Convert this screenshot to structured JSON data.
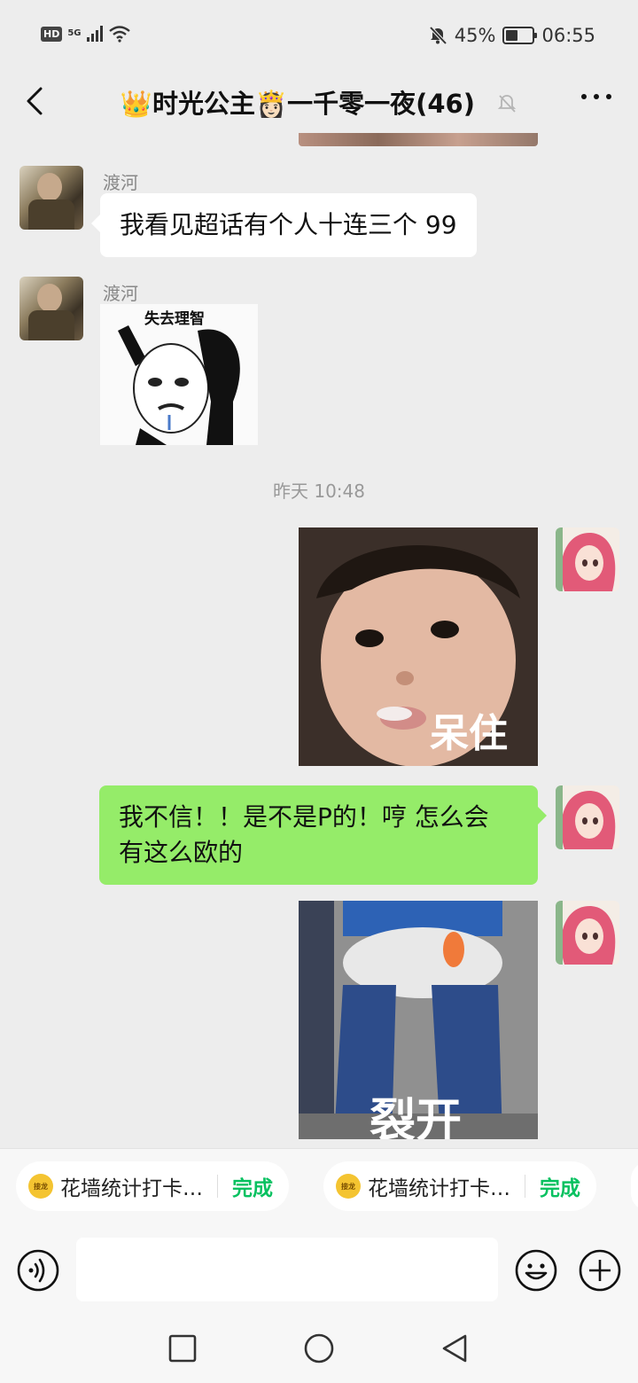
{
  "status_bar": {
    "battery": "45%",
    "time": "06:55",
    "network": "5G",
    "hd_label": "HD"
  },
  "header": {
    "title": "👑时光公主👸🏻一千零一夜(46)"
  },
  "messages": [
    {
      "sender": "渡河",
      "text": "我看见超话有个人十连三个 99"
    },
    {
      "sender": "渡河",
      "sticker_caption": "失去理智"
    },
    {
      "timestamp": "昨天 10:48"
    },
    {
      "from_me": true,
      "sticker_caption": "呆住"
    },
    {
      "from_me": true,
      "text_line1": "我不信！！是不是P的！哼 怎么会",
      "text_line2": "有这么欧的"
    },
    {
      "from_me": true,
      "sticker_caption": "裂开"
    }
  ],
  "quick_actions": [
    {
      "logo": "接龙",
      "label": "花墙统计打卡…",
      "action": "完成"
    },
    {
      "logo": "接龙",
      "label": "花墙统计打卡…",
      "action": "完成"
    }
  ],
  "icons": [
    "back-arrow-icon",
    "mute-bell-icon",
    "more-icon",
    "voice-icon",
    "emoji-icon",
    "plus-icon",
    "nav-back-icon",
    "nav-home-icon",
    "nav-recent-icon"
  ],
  "colors": {
    "my_bubble": "#95ec69",
    "other_bubble": "#ffffff",
    "done": "#07c160"
  }
}
